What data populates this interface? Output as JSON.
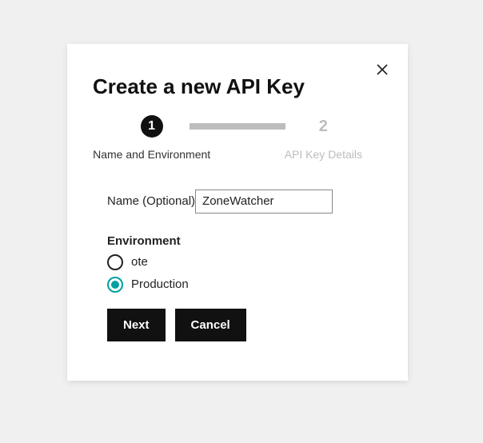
{
  "modal": {
    "title": "Create a new API Key",
    "steps": [
      {
        "num": "1",
        "label": "Name and Environment",
        "active": true
      },
      {
        "num": "2",
        "label": "API Key Details",
        "active": false
      }
    ],
    "name_field": {
      "label": "Name (Optional)",
      "value": "ZoneWatcher"
    },
    "environment": {
      "label": "Environment",
      "options": [
        {
          "label": "ote",
          "selected": false
        },
        {
          "label": "Production",
          "selected": true
        }
      ]
    },
    "buttons": {
      "next": "Next",
      "cancel": "Cancel"
    },
    "accent_color": "#00a0a0"
  }
}
